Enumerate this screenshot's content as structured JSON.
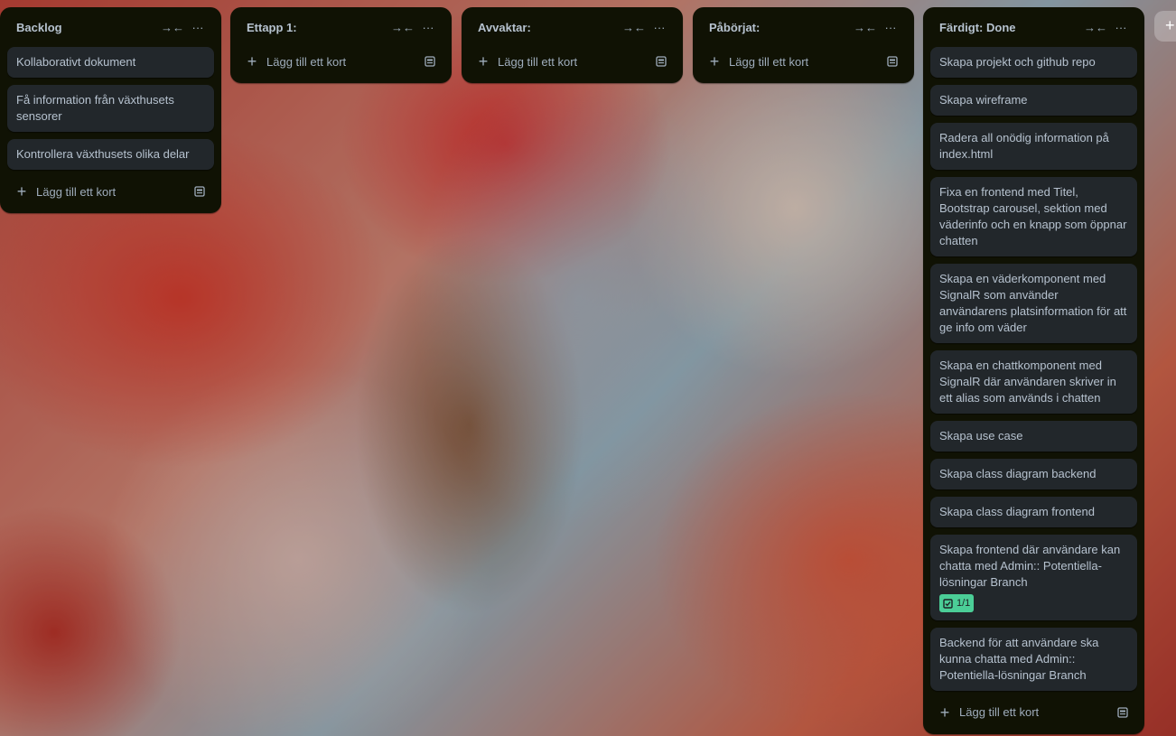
{
  "lists": [
    {
      "title": "Backlog",
      "cards": [
        {
          "text": "Kollaborativt dokument"
        },
        {
          "text": "Få information från växthusets sensorer"
        },
        {
          "text": "Kontrollera växthusets olika delar"
        }
      ],
      "add_label": "Lägg till ett kort"
    },
    {
      "title": "Ettapp 1:",
      "cards": [],
      "add_label": "Lägg till ett kort"
    },
    {
      "title": "Avvaktar:",
      "cards": [],
      "add_label": "Lägg till ett kort"
    },
    {
      "title": "Påbörjat:",
      "cards": [],
      "add_label": "Lägg till ett kort"
    },
    {
      "title": "Färdigt: Done",
      "cards": [
        {
          "text": "Skapa projekt och github repo"
        },
        {
          "text": "Skapa wireframe"
        },
        {
          "text": "Radera all onödig information på index.html"
        },
        {
          "text": "Fixa en frontend med Titel, Bootstrap carousel, sektion med väderinfo och en knapp som öppnar chatten"
        },
        {
          "text": "Skapa en väderkomponent med SignalR som använder användarens platsinformation för att ge info om väder"
        },
        {
          "text": "Skapa en chattkomponent med SignalR där användaren skriver in ett alias som används i chatten"
        },
        {
          "text": "Skapa use case"
        },
        {
          "text": "Skapa class diagram backend"
        },
        {
          "text": "Skapa class diagram frontend"
        },
        {
          "text": "Skapa frontend där användare kan chatta med Admin:: Potentiella-lösningar Branch",
          "checklist": "1/1"
        },
        {
          "text": "Backend för att användare ska kunna chatta med Admin:: Potentiella-lösningar Branch"
        }
      ],
      "add_label": "Lägg till ett kort"
    }
  ],
  "icons": {
    "collapse": "collapse-arrows-icon",
    "more": "more-dots-icon",
    "plus": "plus-icon",
    "template": "card-template-icon",
    "checklist": "checklist-icon"
  },
  "colors": {
    "list_bg": "#101204",
    "card_bg": "#22272b",
    "text": "#b6c2cf",
    "badge_green": "#4bce97"
  }
}
